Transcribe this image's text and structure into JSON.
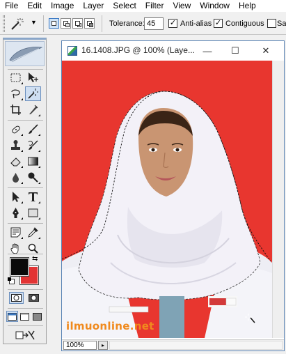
{
  "menu": [
    "File",
    "Edit",
    "Image",
    "Layer",
    "Select",
    "Filter",
    "View",
    "Window",
    "Help"
  ],
  "options": {
    "tolerance_label": "Tolerance:",
    "tolerance_value": "45",
    "antialias_label": "Anti-alias",
    "contiguous_label": "Contiguous",
    "sample_label": "Sa",
    "antialias_checked": true,
    "contiguous_checked": true,
    "sample_checked": false
  },
  "tools": [
    "marquee-icon",
    "move-icon",
    "lasso-icon",
    "magic-wand-icon",
    "crop-icon",
    "slice-icon",
    "healing-brush-icon",
    "brush-icon",
    "stamp-icon",
    "history-brush-icon",
    "eraser-icon",
    "gradient-icon",
    "blur-icon",
    "dodge-icon",
    "path-select-icon",
    "type-icon",
    "pen-icon",
    "shape-icon",
    "notes-icon",
    "eyedropper-icon",
    "hand-icon",
    "zoom-icon"
  ],
  "colors": {
    "foreground": "#0a0a0a",
    "background": "#e23434",
    "canvas_red": "#e8362f"
  },
  "document": {
    "title": "16.1408.JPG @ 100% (Laye...",
    "minimize": "—",
    "maximize": "☐",
    "close": "✕",
    "zoom": "100%",
    "watermark": "ilmuonline.net"
  }
}
